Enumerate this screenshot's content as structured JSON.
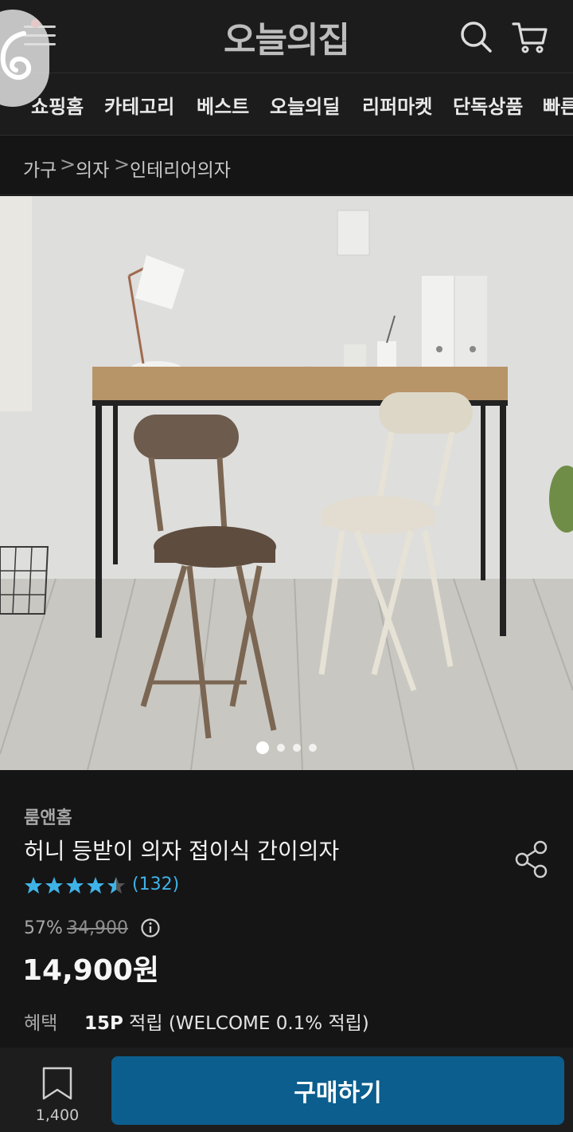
{
  "header": {
    "logo": "오늘의집",
    "icons": [
      "menu-icon",
      "search-icon",
      "cart-icon"
    ]
  },
  "category_nav": {
    "items": [
      "쇼핑홈",
      "카테고리",
      "베스트",
      "오늘의딜",
      "리퍼마켓",
      "단독상품",
      "빠른"
    ]
  },
  "breadcrumb": {
    "items": [
      "가구",
      "의자",
      "인테리어의자"
    ],
    "separator": ">"
  },
  "gallery": {
    "page_count": 4,
    "active_index": 0
  },
  "product": {
    "brand": "룸앤홈",
    "title": "허니 등받이 의자 접이식 간이의자",
    "rating": 4.5,
    "review_count": "(132)",
    "discount": "57%",
    "original_price": "34,900",
    "price": "14,900원",
    "benefit_label": "혜택",
    "benefit_points": "15P",
    "benefit_rest": " 적립 (WELCOME 0.1% 적립)"
  },
  "bottom_bar": {
    "bookmark_count": "1,400",
    "buy_label": "구매하기"
  },
  "colors": {
    "accent": "#0b5e8e",
    "star": "#3fb3e8",
    "notification": "#ff3d3d"
  }
}
